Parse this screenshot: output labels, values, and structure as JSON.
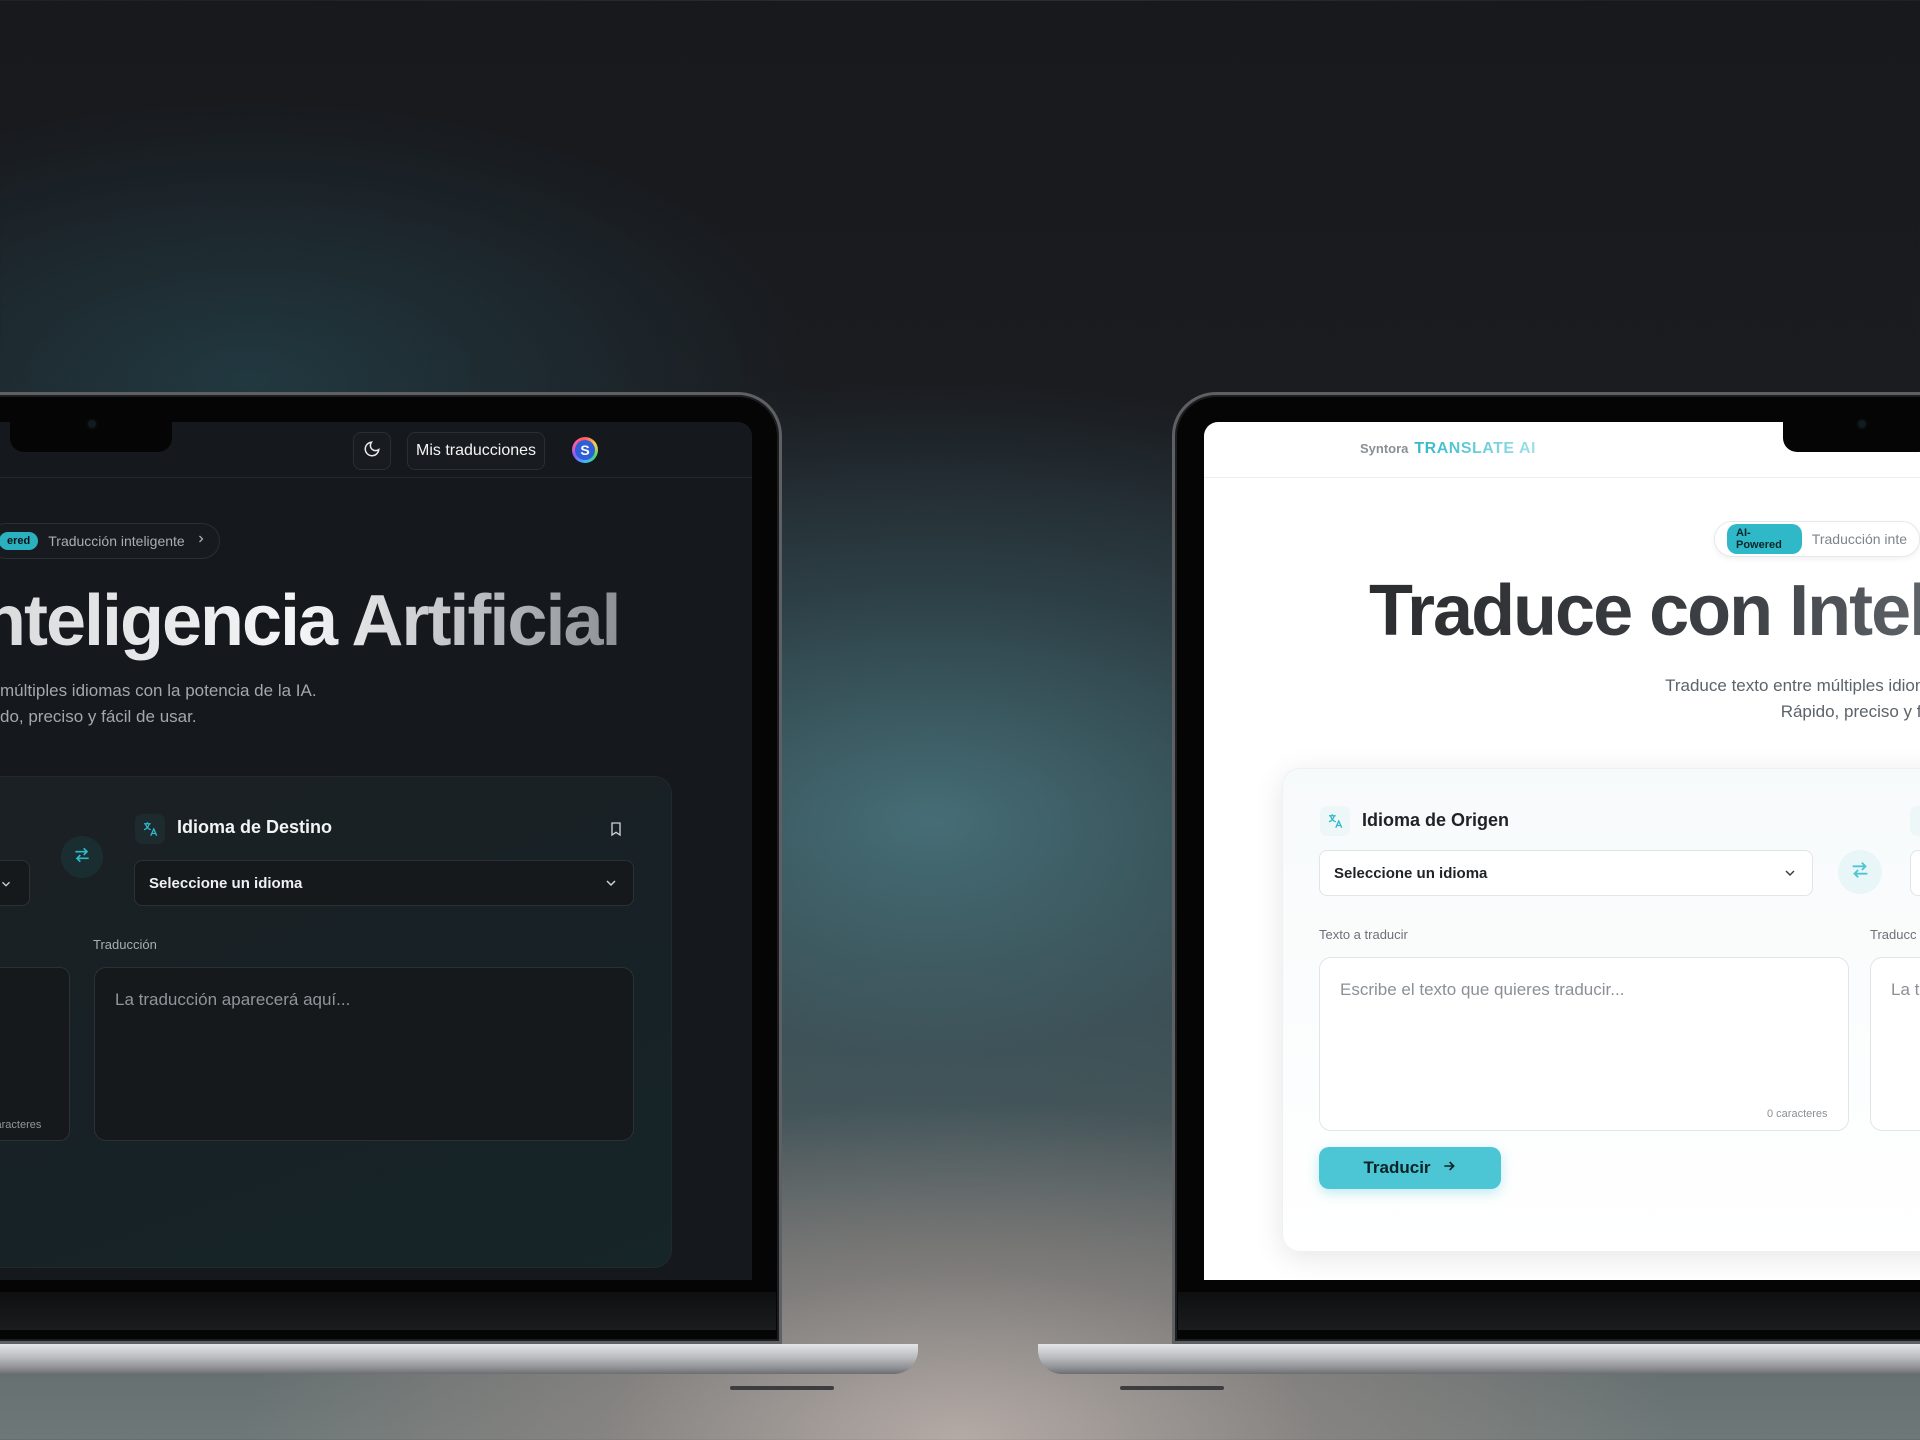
{
  "colors": {
    "accent": "#2fb8c8",
    "dark_bg": "#15181c",
    "light_bg": "#ffffff",
    "button": "#4cc6d4"
  },
  "dark_screen": {
    "topbar": {
      "theme_toggle_icon": "moon-icon",
      "nav_button": "Mis traducciones",
      "avatar_initial": "S"
    },
    "badge": {
      "tag": "ered",
      "text": "Traducción inteligente",
      "chevron_icon": "chevron-right-icon"
    },
    "hero_title": "nteligencia Artificial",
    "subtitle_line1": "múltiples idiomas con la potencia de la IA.",
    "subtitle_line2": "do, preciso y fácil de usar.",
    "target_language": {
      "title": "Idioma de Destino",
      "select_value": "Seleccione un idioma",
      "bookmark_icon": "bookmark-icon"
    },
    "translation_label": "Traducción",
    "translation_placeholder": "La traducción aparecerá aquí...",
    "char_count": "caracteres"
  },
  "light_screen": {
    "logo": {
      "brand": "Syntora",
      "product": "TRANSLATE AI"
    },
    "badge": {
      "tag": "AI-Powered",
      "text": "Traducción inte"
    },
    "hero_title": "Traduce con Intelig",
    "subtitle_line1": "Traduce texto entre múltiples idiomas",
    "subtitle_line2": "Rápido, preciso y fácil",
    "source_language": {
      "title": "Idioma de Origen",
      "select_value": "Seleccione un idioma"
    },
    "input_label": "Texto a traducir",
    "input_placeholder": "Escribe el texto que quieres traducir...",
    "char_count": "0 caracteres",
    "output_label": "Traducc",
    "output_placeholder": "La t",
    "translate_button": "Traducir"
  }
}
